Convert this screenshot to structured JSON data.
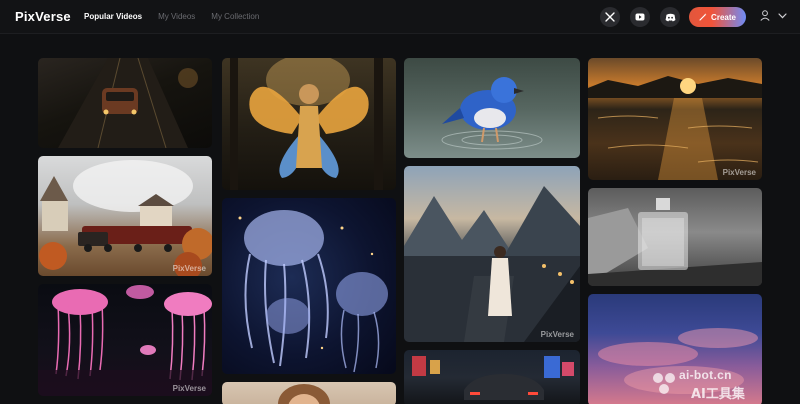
{
  "header": {
    "logo": "PixVerse",
    "nav": [
      "Popular Videos",
      "My Videos",
      "My Collection"
    ],
    "create_label": "Create"
  },
  "colors": {
    "background": "#0f1012",
    "accent_gradient_start": "#f0543a",
    "accent_gradient_end": "#6f8cf6"
  },
  "icons": {
    "social": [
      "x-twitter-icon",
      "youtube-icon",
      "discord-icon"
    ],
    "create": "wand-icon",
    "user": [
      "user-icon",
      "chevron-down-icon"
    ]
  },
  "gallery": {
    "watermark": "PixVerse",
    "columns": [
      [
        "classic car on night road",
        "steam train in autumn village",
        "pink jellyfish over water"
      ],
      [
        "golden fairy with butterfly wings",
        "glowing jellyfish in deep sea",
        "portrait"
      ],
      [
        "blue bird standing in water",
        "woman walking on lakeside boardwalk at dusk",
        "sports car on neon city street"
      ],
      [
        "sunset over rippling lake",
        "perfume bottle on stone",
        "pink clouds at dusk"
      ]
    ]
  },
  "corner_watermark": {
    "url": "ai-bot.cn",
    "name": "AI工具集"
  }
}
